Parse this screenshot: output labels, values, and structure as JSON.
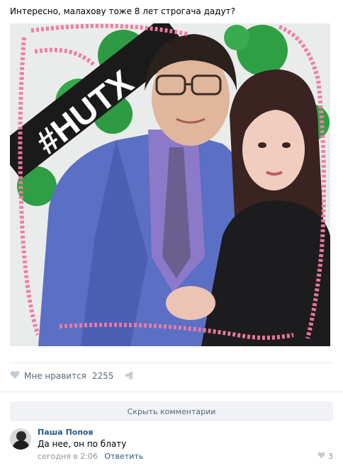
{
  "post": {
    "text": "Интересно, малахову тоже 8 лет строгача дадут?",
    "photo_overlay_text": "#HUTX"
  },
  "actions": {
    "like_label": "Мне нравится",
    "like_count": "2255"
  },
  "comments": {
    "hide_label": "Скрыть комментарии",
    "items": [
      {
        "author": "Паша Попов",
        "text": "Да нее, он по блату",
        "time": "сегодня в 2:06",
        "reply_label": "Ответить",
        "likes": "3"
      }
    ]
  },
  "colors": {
    "link": "#2a5885",
    "muted": "#939393",
    "heart_frame": "#f07aa0",
    "balloon_green": "#2ea043"
  }
}
